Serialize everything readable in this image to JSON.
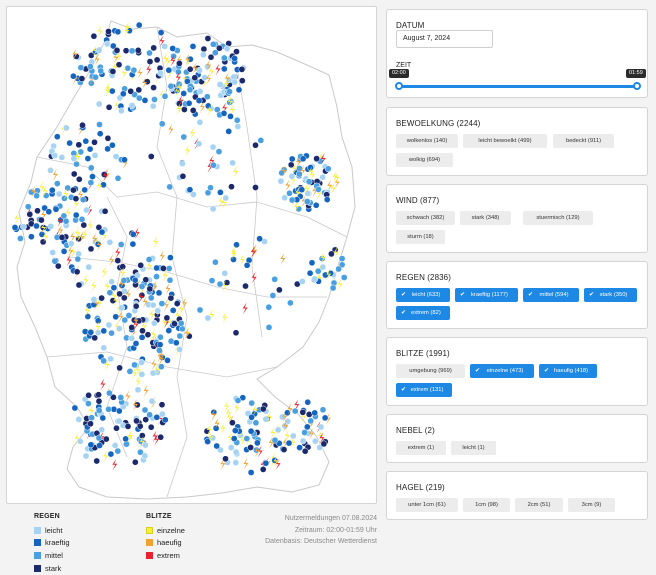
{
  "map": {
    "colors": {
      "regen": [
        "#a6d3f3",
        "#1565c0",
        "#4a9fe0",
        "#1a2a6c"
      ],
      "blitze": [
        "#f8ef3a",
        "#f0a230",
        "#e8232f"
      ],
      "border": "#c9c9c9"
    },
    "legend": {
      "regen": {
        "title": "REGEN",
        "items": [
          {
            "label": "leicht",
            "color": "#a6d3f3"
          },
          {
            "label": "kraeftig",
            "color": "#1565c0"
          },
          {
            "label": "mittel",
            "color": "#4a9fe0"
          },
          {
            "label": "stark",
            "color": "#1a2a6c"
          }
        ]
      },
      "blitze": {
        "title": "BLITZE",
        "items": [
          {
            "label": "einzelne",
            "color": "#f8ef3a"
          },
          {
            "label": "haeufig",
            "color": "#f0a230"
          },
          {
            "label": "extrem",
            "color": "#e8232f"
          }
        ]
      }
    },
    "info": {
      "line1": "Nutzermeldungen 07.08.2024",
      "line2": "Zeitraum: 02:00-01:59 Uhr",
      "line3": "Datenbasis: Deutscher Wetterdienst"
    }
  },
  "filters": {
    "datum": {
      "label": "DATUM",
      "value": "August 7, 2024"
    },
    "zeit": {
      "label": "ZEIT",
      "start": "02:00",
      "end": "01:59"
    },
    "bewoelkung": {
      "title": "BEWOELKUNG (2244)",
      "chips": [
        "wolkenlos (140)",
        "leicht bewoelkt (499)",
        "bedeckt (911)",
        "wolkig (694)"
      ]
    },
    "wind": {
      "title": "WIND (877)",
      "chips": [
        "schwach (382)",
        "stark (348)",
        "stuermisch (129)",
        "sturm (18)"
      ]
    },
    "regen": {
      "title": "REGEN (2836)",
      "chips": [
        "leicht (633)",
        "kraeftig (1177)",
        "mittel (594)",
        "stark (350)",
        "extrem (82)"
      ],
      "check": "✔"
    },
    "blitze": {
      "title": "BLITZE (1991)",
      "chips": [
        "umgebung (969)",
        "einzelne (473)",
        "haeufig (418)",
        "extrem (131)"
      ],
      "check": "✔"
    },
    "nebel": {
      "title": "NEBEL (2)",
      "chips": [
        "extrem (1)",
        "leicht (1)"
      ]
    },
    "hagel": {
      "title": "HAGEL (219)",
      "chips": [
        "unter 1cm (61)",
        "1cm (98)",
        "2cm (51)",
        "3cm (9)"
      ]
    }
  }
}
